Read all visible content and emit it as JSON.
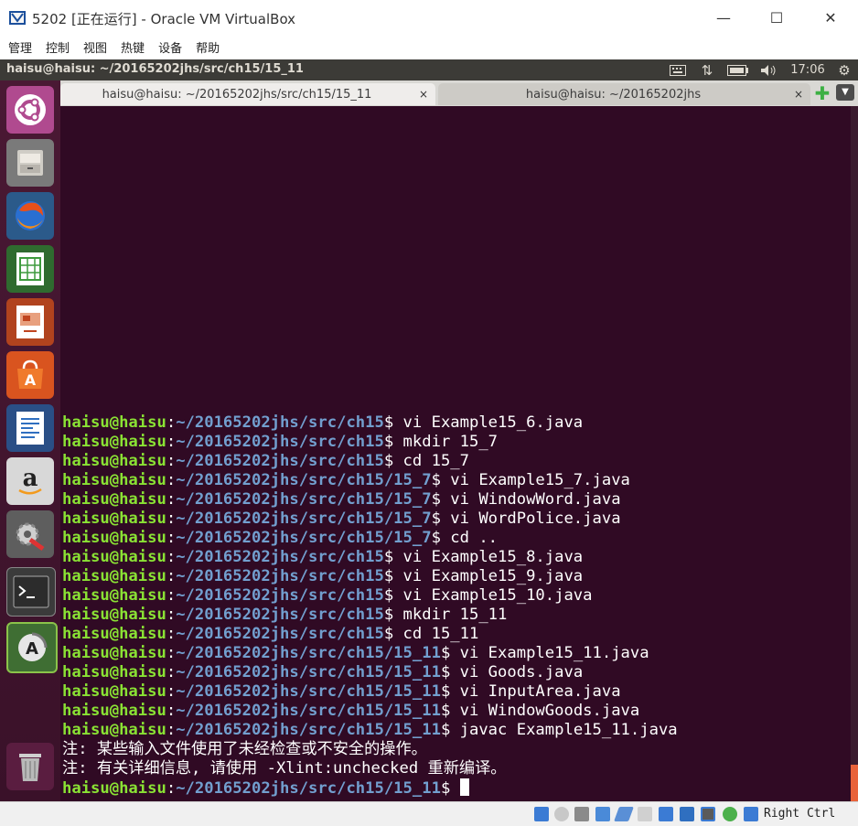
{
  "window": {
    "title": "5202 [正在运行] - Oracle VM VirtualBox",
    "minimize": "—",
    "maximize": "☐",
    "close": "✕"
  },
  "menu": [
    "管理",
    "控制",
    "视图",
    "热键",
    "设备",
    "帮助"
  ],
  "topbar": {
    "title": "haisu@haisu: ~/20165202jhs/src/ch15/15_11",
    "time": "17:06",
    "icons": [
      "keyboard-icon",
      "network-icon",
      "battery-icon",
      "volume-icon",
      "power-gear-icon"
    ]
  },
  "launcher": [
    "ubuntu-dash-icon",
    "files-icon",
    "firefox-icon",
    "calc-spreadsheet-icon",
    "impress-presentation-icon",
    "software-center-icon",
    "writer-document-icon",
    "amazon-icon",
    "system-settings-icon",
    "terminal-icon",
    "software-updater-icon",
    "trash-icon"
  ],
  "tabs": [
    {
      "label": "haisu@haisu: ~/20165202jhs/src/ch15/15_11",
      "close": "×",
      "active": true
    },
    {
      "label": "haisu@haisu: ~/20165202jhs",
      "close": "×",
      "active": false
    }
  ],
  "terminal": {
    "background": "#300a24",
    "user_color": "#8ae234",
    "path_color": "#729fcf",
    "lines": [
      {
        "user": "haisu@haisu",
        "path": "~/20165202jhs/src/ch15",
        "cmd": "vi Example15_6.java"
      },
      {
        "user": "haisu@haisu",
        "path": "~/20165202jhs/src/ch15",
        "cmd": "mkdir 15_7"
      },
      {
        "user": "haisu@haisu",
        "path": "~/20165202jhs/src/ch15",
        "cmd": "cd 15_7"
      },
      {
        "user": "haisu@haisu",
        "path": "~/20165202jhs/src/ch15/15_7",
        "cmd": "vi Example15_7.java"
      },
      {
        "user": "haisu@haisu",
        "path": "~/20165202jhs/src/ch15/15_7",
        "cmd": "vi WindowWord.java"
      },
      {
        "user": "haisu@haisu",
        "path": "~/20165202jhs/src/ch15/15_7",
        "cmd": "vi WordPolice.java"
      },
      {
        "user": "haisu@haisu",
        "path": "~/20165202jhs/src/ch15/15_7",
        "cmd": "cd .."
      },
      {
        "user": "haisu@haisu",
        "path": "~/20165202jhs/src/ch15",
        "cmd": "vi Example15_8.java"
      },
      {
        "user": "haisu@haisu",
        "path": "~/20165202jhs/src/ch15",
        "cmd": "vi Example15_9.java"
      },
      {
        "user": "haisu@haisu",
        "path": "~/20165202jhs/src/ch15",
        "cmd": "vi Example15_10.java"
      },
      {
        "user": "haisu@haisu",
        "path": "~/20165202jhs/src/ch15",
        "cmd": "mkdir 15_11"
      },
      {
        "user": "haisu@haisu",
        "path": "~/20165202jhs/src/ch15",
        "cmd": "cd 15_11"
      },
      {
        "user": "haisu@haisu",
        "path": "~/20165202jhs/src/ch15/15_11",
        "cmd": "vi Example15_11.java"
      },
      {
        "user": "haisu@haisu",
        "path": "~/20165202jhs/src/ch15/15_11",
        "cmd": "vi Goods.java"
      },
      {
        "user": "haisu@haisu",
        "path": "~/20165202jhs/src/ch15/15_11",
        "cmd": "vi InputArea.java"
      },
      {
        "user": "haisu@haisu",
        "path": "~/20165202jhs/src/ch15/15_11",
        "cmd": "vi WindowGoods.java"
      },
      {
        "user": "haisu@haisu",
        "path": "~/20165202jhs/src/ch15/15_11",
        "cmd": "javac Example15_11.java"
      },
      {
        "text": "注: 某些输入文件使用了未经检查或不安全的操作。"
      },
      {
        "text": "注: 有关详细信息, 请使用 -Xlint:unchecked 重新编译。"
      },
      {
        "user": "haisu@haisu",
        "path": "~/20165202jhs/src/ch15/15_11",
        "cmd": "",
        "cursor": true
      }
    ]
  },
  "statusbar": {
    "icons": [
      "hard-disk-icon",
      "optical-drive-icon",
      "audio-icon",
      "network-adapter-icon",
      "usb-icon",
      "shared-folder-icon",
      "display-icon",
      "video-capture-icon",
      "cpu-icon",
      "globe-icon",
      "mouse-integration-icon"
    ],
    "host_key": "Right Ctrl"
  }
}
